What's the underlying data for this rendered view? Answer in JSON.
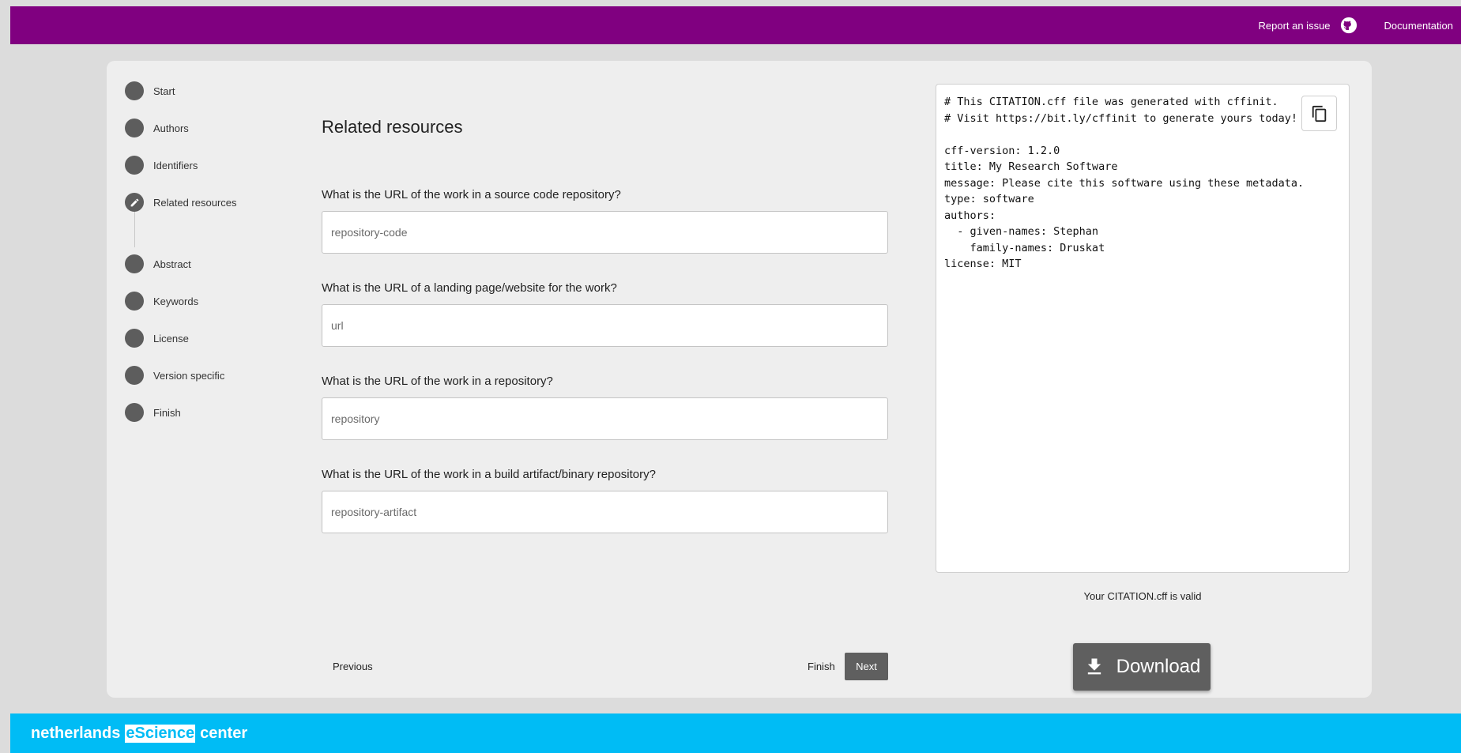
{
  "header": {
    "report_label": "Report an issue",
    "docs_label": "Documentation",
    "bg_color": "#800080"
  },
  "stepper": {
    "steps": [
      {
        "label": "Start",
        "state": "pending"
      },
      {
        "label": "Authors",
        "state": "pending"
      },
      {
        "label": "Identifiers",
        "state": "pending"
      },
      {
        "label": "Related resources",
        "state": "active"
      },
      {
        "label": "Abstract",
        "state": "pending"
      },
      {
        "label": "Keywords",
        "state": "pending"
      },
      {
        "label": "License",
        "state": "pending"
      },
      {
        "label": "Version specific",
        "state": "pending"
      },
      {
        "label": "Finish",
        "state": "pending"
      }
    ]
  },
  "form": {
    "title": "Related resources",
    "fields": [
      {
        "question": "What is the URL of the work in a source code repository?",
        "placeholder": "repository-code",
        "value": ""
      },
      {
        "question": "What is the URL of a landing page/website for the work?",
        "placeholder": "url",
        "value": ""
      },
      {
        "question": "What is the URL of the work in a repository?",
        "placeholder": "repository",
        "value": ""
      },
      {
        "question": "What is the URL of the work in a build artifact/binary repository?",
        "placeholder": "repository-artifact",
        "value": ""
      }
    ],
    "previous_label": "Previous",
    "finish_label": "Finish",
    "next_label": "Next"
  },
  "preview": {
    "content": "# This CITATION.cff file was generated with cffinit.\n# Visit https://bit.ly/cffinit to generate yours today!\n\ncff-version: 1.2.0\ntitle: My Research Software\nmessage: Please cite this software using these metadata.\ntype: software\nauthors:\n  - given-names: Stephan\n    family-names: Druskat\nlicense: MIT",
    "copy_icon": "copy-icon",
    "validity_text": "Your CITATION.cff is valid",
    "download_label": "Download"
  },
  "footer": {
    "brand_pre": "netherlands",
    "brand_highlight": "eScience",
    "brand_post": "center",
    "bg_color": "#00bcf5"
  }
}
